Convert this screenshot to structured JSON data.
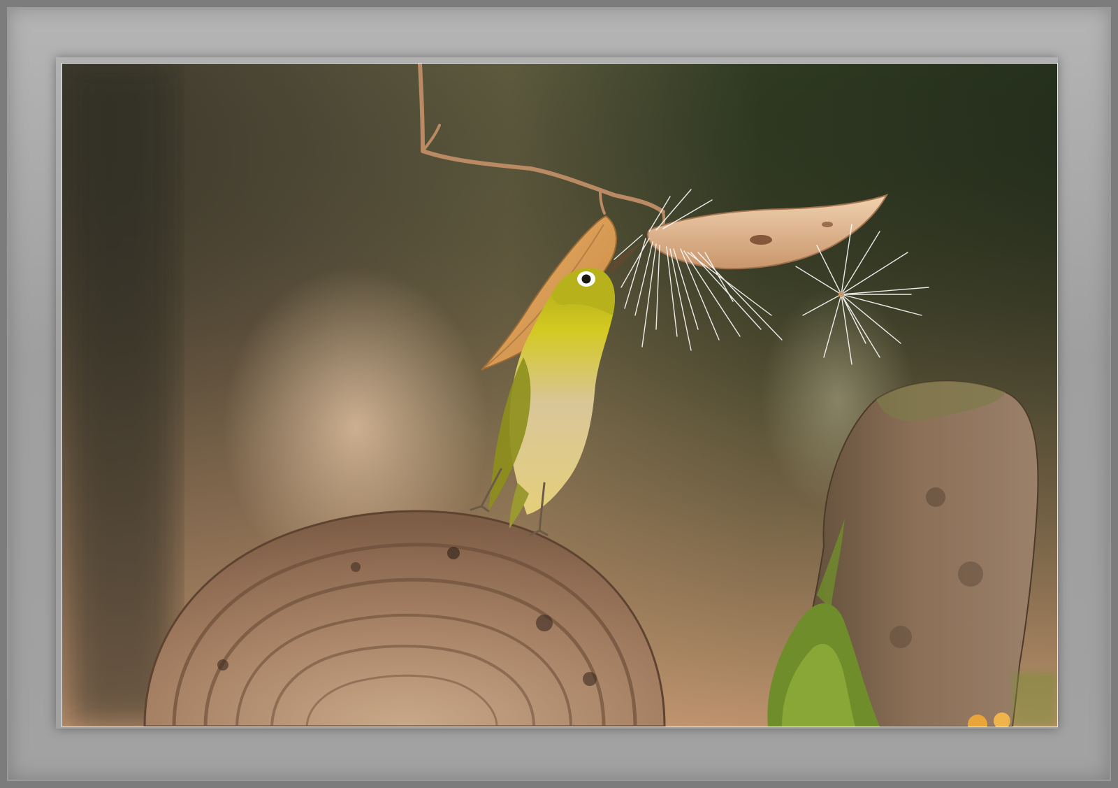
{
  "scene": {
    "subject": "bird-on-bracket-fungus",
    "colors": {
      "bg_dark": "#3b3a2c",
      "bg_green": "#28331f",
      "bg_warm": "#c89670",
      "bird_yellow": "#c9c21c",
      "bird_olive": "#8d8f1c",
      "bird_belly": "#d8c59a",
      "leaf": "#d89a55",
      "fungus": "#a37d62",
      "rock": "#8a6e58",
      "moss": "#6f8d2b",
      "fluff": "#ffffff"
    }
  }
}
